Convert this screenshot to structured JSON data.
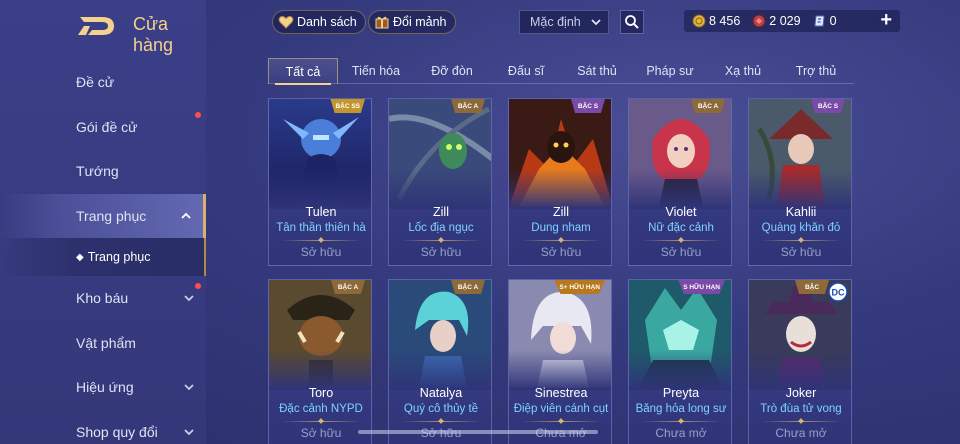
{
  "store": {
    "title": "Cửa hàng"
  },
  "sidebar": {
    "items": [
      {
        "label": "Đề cử"
      },
      {
        "label": "Gói đề cử"
      },
      {
        "label": "Tướng"
      },
      {
        "label": "Trang phục"
      },
      {
        "label": "Kho báu"
      },
      {
        "label": "Vật phẩm"
      },
      {
        "label": "Hiệu ứng"
      },
      {
        "label": "Shop quy đổi"
      }
    ],
    "sub_item": {
      "bullet": "◆",
      "label": "Trang phục"
    }
  },
  "topbar": {
    "list_label": "Danh sách",
    "exchange_label": "Đổi mảnh",
    "sort_value": "Mặc định",
    "currency": {
      "gold": "8 456",
      "gems": "2 029",
      "vouchers": "0"
    }
  },
  "tabs": [
    "Tất cả",
    "Tiến hóa",
    "Đỡ đòn",
    "Đấu sĩ",
    "Sát thủ",
    "Pháp sư",
    "Xạ thủ",
    "Trợ thủ"
  ],
  "cards": [
    {
      "hero": "Tulen",
      "skin": "Tân thần thiên hà",
      "badge": "BẬC SS",
      "status": "Sở hữu"
    },
    {
      "hero": "Zill",
      "skin": "Lốc địa ngục",
      "badge": "BẬC A",
      "status": "Sở hữu"
    },
    {
      "hero": "Zill",
      "skin": "Dung nham",
      "badge": "BẬC S",
      "status": "Sở hữu"
    },
    {
      "hero": "Violet",
      "skin": "Nữ đặc cảnh",
      "badge": "BẬC A",
      "status": "Sở hữu"
    },
    {
      "hero": "Kahlii",
      "skin": "Quàng khăn đỏ",
      "badge": "BẬC S",
      "status": "Sở hữu"
    },
    {
      "hero": "Toro",
      "skin": "Đặc cảnh NYPD",
      "badge": "BẬC A",
      "status": "Sở hữu"
    },
    {
      "hero": "Natalya",
      "skin": "Quý cô thủy tề",
      "badge": "BẬC A",
      "status": "Sở hữu"
    },
    {
      "hero": "Sinestrea",
      "skin": "Điệp viên cánh cụt",
      "badge": "S+ HỮU HẠN",
      "status": "Chưa mở"
    },
    {
      "hero": "Preyta",
      "skin": "Băng hỏa long sư",
      "badge": "S HỮU HẠN",
      "status": "Chưa mở"
    },
    {
      "hero": "Joker",
      "skin": "Trò đùa tử vong",
      "badge": "BẬC",
      "status": "Chưa mở"
    }
  ],
  "colors": {
    "accent_gold": "#f2d28e",
    "skin_name": "#7fd2ff",
    "badge_ss": "#c2962e",
    "badge_a": "#8e6a3a",
    "badge_s": "#7a4aa8"
  },
  "icons": [
    "heart-icon",
    "gift-icon",
    "magnifier-icon",
    "gold-coin-icon",
    "gem-icon",
    "voucher-icon",
    "plus-icon",
    "chevron-up-icon",
    "chevron-down-icon",
    "dc-logo-icon"
  ]
}
